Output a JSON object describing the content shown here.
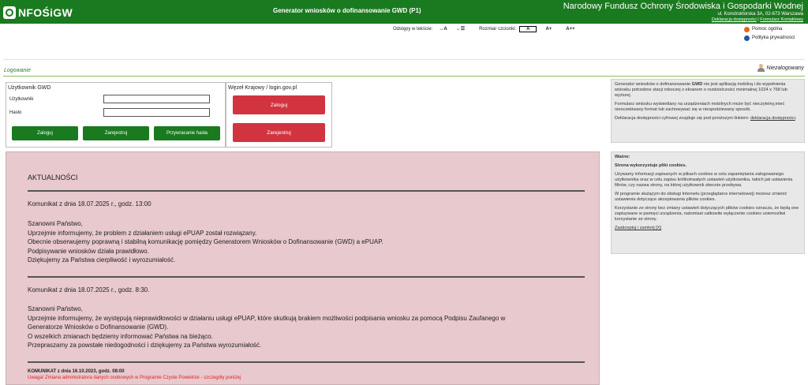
{
  "header": {
    "logo_text": "NFOŚiGW",
    "app_title": "Generator wniosków o dofinansowanie GWD (P1)",
    "org_name": "Narodowy Fundusz Ochrony Środowiska i Gospodarki Wodnej",
    "org_address": "ul. Konstruktorska 3A, 02-673 Warszawa",
    "link_accessibility": "Deklaracja dostępności",
    "link_separator": " | ",
    "link_contact": "Formularz Kontaktowy"
  },
  "accessibility": {
    "spacing_label": "Odstępy w tekście:",
    "spacing_btn_1": "↔A",
    "spacing_btn_2": "↔☰",
    "font_label": "Rozmiar czcionki:",
    "font_btn_1": "A",
    "font_btn_2": "A+",
    "font_btn_3": "A++"
  },
  "help": {
    "general_help": "Pomoc ogólna",
    "privacy_policy": "Polityka prywatności"
  },
  "login": {
    "title": "Logowanie",
    "status": "Niezalogowany",
    "gwd_panel_title": "Użytkownik GWD",
    "user_label": "Użytkownik",
    "user_value": "",
    "password_label": "Hasło",
    "password_value": "",
    "login_button": "Zaloguj",
    "register_button": "Zarejestruj",
    "reset_button": "Przywracanie hasła",
    "wk_panel_title": "Węzeł Krajowy / login.gov.pl",
    "wk_login_button": "Zaloguj",
    "wk_register_button": "Zarejestruj"
  },
  "info": {
    "p1_a": "Generator wniosków o dofinansowanie ",
    "p1_b": "GWD",
    "p1_c": " nie jest aplikacją mobilną i do wypełnienia wniosku potrzebne stacji roboczej z ekranem o rozdzielczości minimalnej 1024 x 768 lub wyższej.",
    "p2": "Formularz wniosku wyświetlany na urządzeniach mobilnych może być nieczytelny,mieć nieoczekiwany format lub zachowywać się w niespodziewany sposób.",
    "p3_a": "Deklaracja dostępności cyfrowej znajduje się pod poniższym linkiem: ",
    "p3_link": "deklaracja dostępności",
    "p3_c": "."
  },
  "news": {
    "title": "AKTUALNOŚCI",
    "item1_header": "Komunikat z dnia 18.07.2025 r., godz. 13:00",
    "item1_lines": [
      "Szanowni Państwo,",
      "Uprzejmie informujemy, że problem z działaniem usługi ePUAP został rozwiązany.",
      "Obecnie obserwujemy poprawną i stabilną komunikację pomiędzy Generatorem Wniosków o Dofinansowanie (GWD) a ePUAP.",
      "Podpisywanie wniosków działa prawidłowo.",
      "Dziękujemy za Państwa cierpliwość i wyrozumiałość."
    ],
    "item2_header": "Komunikat z dnia 18.07.2025 r., godz. 8:30.",
    "item2_lines": [
      "Szanowni Państwo,",
      "Uprzejmie informujemy, że występują nieprawidłowości w działaniu usługi ePUAP, które skutkują brakiem możliwości podpisania wniosku za pomocą Podpisu Zaufanego w",
      "Generatorze Wniosków o Dofinansowanie (GWD).",
      "O wszelkich zmianach będziemy informować Państwa na bieżąco.",
      "Przepraszamy za powstałe niedogodności i dziękujemy za Państwa wyrozumiałość."
    ],
    "item3_header": "KOMUNIKAT z dnia 16.10.2023, godz. 08:00",
    "item3_sub": "Uwaga! Zmiana administratora danych osobowych w Programie Czyste Powietrze - szczegóły poniżej"
  },
  "cookies": {
    "heading": "Ważne:",
    "subheading": "Strona wykorzystuje pliki cookies.",
    "p1": "Używamy informacji zapisanych w plikach cookies w celu zapamiętania zalogowanego użytkownika oraz w celu zapisu krótkotrwałych ustawień użytkownika, takich jak ustawienia filtrów, czy nazwa strony, na której użytkownik obecnie przebywa.",
    "p2": "W programie służącym do obsługi Internetu (przeglądarce internetowej) możesz zmienić ustawienia dotyczące akceptowania plików cookies.",
    "p3": "Korzystanie ze strony bez zmiany ustawień dotyczących plików cookies oznacza, że będą one zapisywane w pamięci urządzenia, natomiast całkowite wyłączenie cookies uniemożliwi korzystanie ze strony.",
    "accept": "Zaakceptuj i zamknij [X]"
  }
}
